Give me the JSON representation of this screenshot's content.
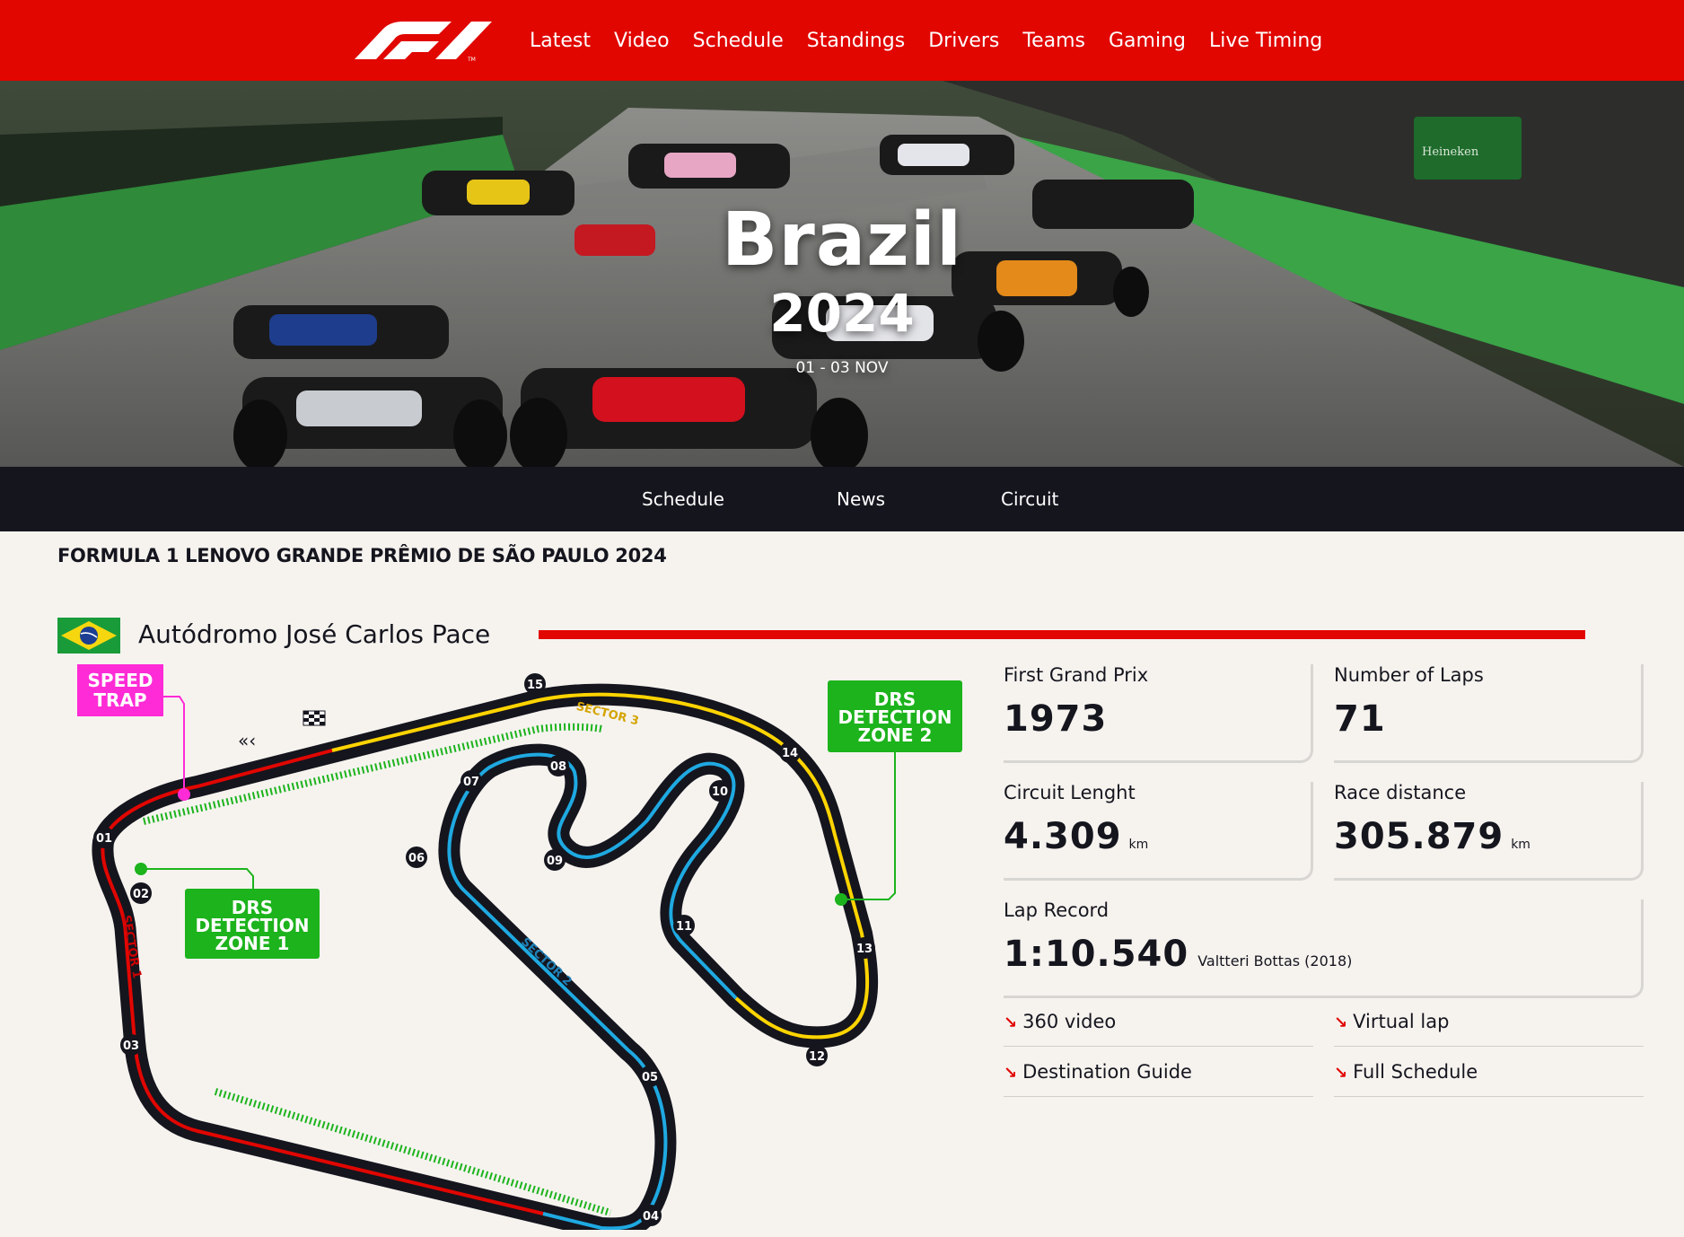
{
  "brand": {
    "logo": "F1",
    "accent": "#e10600",
    "dark": "#15151e"
  },
  "topnav": {
    "items": [
      "Latest",
      "Video",
      "Schedule",
      "Standings",
      "Drivers",
      "Teams",
      "Gaming",
      "Live Timing"
    ]
  },
  "hero": {
    "country": "Brazil",
    "year": "2024",
    "dates": "01 - 03 NOV",
    "billboard": "Heineken"
  },
  "subnav": {
    "items": [
      "Schedule",
      "News",
      "Circuit"
    ]
  },
  "event": {
    "name": "FORMULA 1 LENOVO GRANDE PRÊMIO DE SÃO PAULO 2024"
  },
  "circuit": {
    "flag": "brazil-flag",
    "name": "Autódromo José Carlos Pace",
    "map": {
      "speed_trap": [
        "SPEED",
        "TRAP"
      ],
      "drs_zone_1": [
        "DRS",
        "DETECTION",
        "ZONE 1"
      ],
      "drs_zone_2": [
        "DRS",
        "DETECTION",
        "ZONE 2"
      ],
      "sectors": [
        "SECTOR 1",
        "SECTOR 2",
        "SECTOR 3"
      ],
      "turns": [
        "01",
        "02",
        "03",
        "04",
        "05",
        "06",
        "07",
        "08",
        "09",
        "10",
        "11",
        "12",
        "13",
        "14",
        "15"
      ],
      "colors": {
        "sector1": "#e10600",
        "sector2": "#1fa9e1",
        "sector3": "#ffd400",
        "drs": "#1cb31c",
        "speed_trap": "#ff2bd6"
      }
    }
  },
  "stats": {
    "first_gp": {
      "label": "First Grand Prix",
      "value": "1973"
    },
    "laps": {
      "label": "Number of Laps",
      "value": "71"
    },
    "length": {
      "label": "Circuit Lenght",
      "value": "4.309",
      "unit": "km"
    },
    "distance": {
      "label": "Race distance",
      "value": "305.879",
      "unit": "km"
    },
    "lap_record": {
      "label": "Lap Record",
      "value": "1:10.540",
      "holder": "Valtteri Bottas (2018)"
    }
  },
  "links": [
    "360 video",
    "Virtual lap",
    "Destination Guide",
    "Full Schedule"
  ]
}
